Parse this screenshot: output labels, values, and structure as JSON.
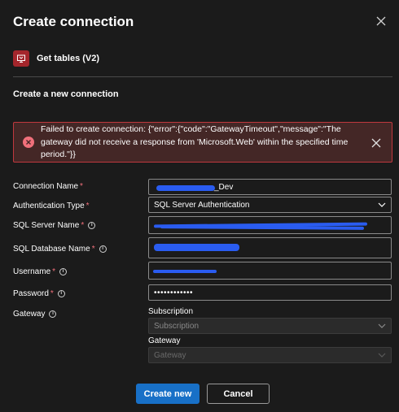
{
  "dialog": {
    "title": "Create connection"
  },
  "action": {
    "label": "Get tables (V2)"
  },
  "section": {
    "title": "Create a new connection"
  },
  "error": {
    "message": "Failed to create connection: {\"error\":{\"code\":\"GatewayTimeout\",\"message\":\"The gateway did not receive a response from 'Microsoft.Web' within the specified time period.\"}}"
  },
  "form": {
    "connection_name": {
      "label": "Connection Name",
      "required": "*",
      "value_visible": "_Dev"
    },
    "auth_type": {
      "label": "Authentication Type",
      "required": "*",
      "value": "SQL Server Authentication"
    },
    "sql_server_name": {
      "label": "SQL Server Name",
      "required": "*"
    },
    "sql_database_name": {
      "label": "SQL Database Name",
      "required": "*"
    },
    "username": {
      "label": "Username",
      "required": "*"
    },
    "password": {
      "label": "Password",
      "required": "*",
      "value": "••••••••••••"
    },
    "gateway": {
      "label": "Gateway"
    }
  },
  "gateway_section": {
    "subscription_label": "Subscription",
    "subscription_placeholder": "Subscription",
    "gateway_label": "Gateway",
    "gateway_placeholder": "Gateway"
  },
  "buttons": {
    "create": "Create new",
    "cancel": "Cancel"
  },
  "colors": {
    "background": "#1b1b1b",
    "primary": "#1870c7",
    "error_border": "#c0383e",
    "error_bg": "#442726",
    "required": "#f1707b",
    "redaction": "#2a5cf0"
  }
}
